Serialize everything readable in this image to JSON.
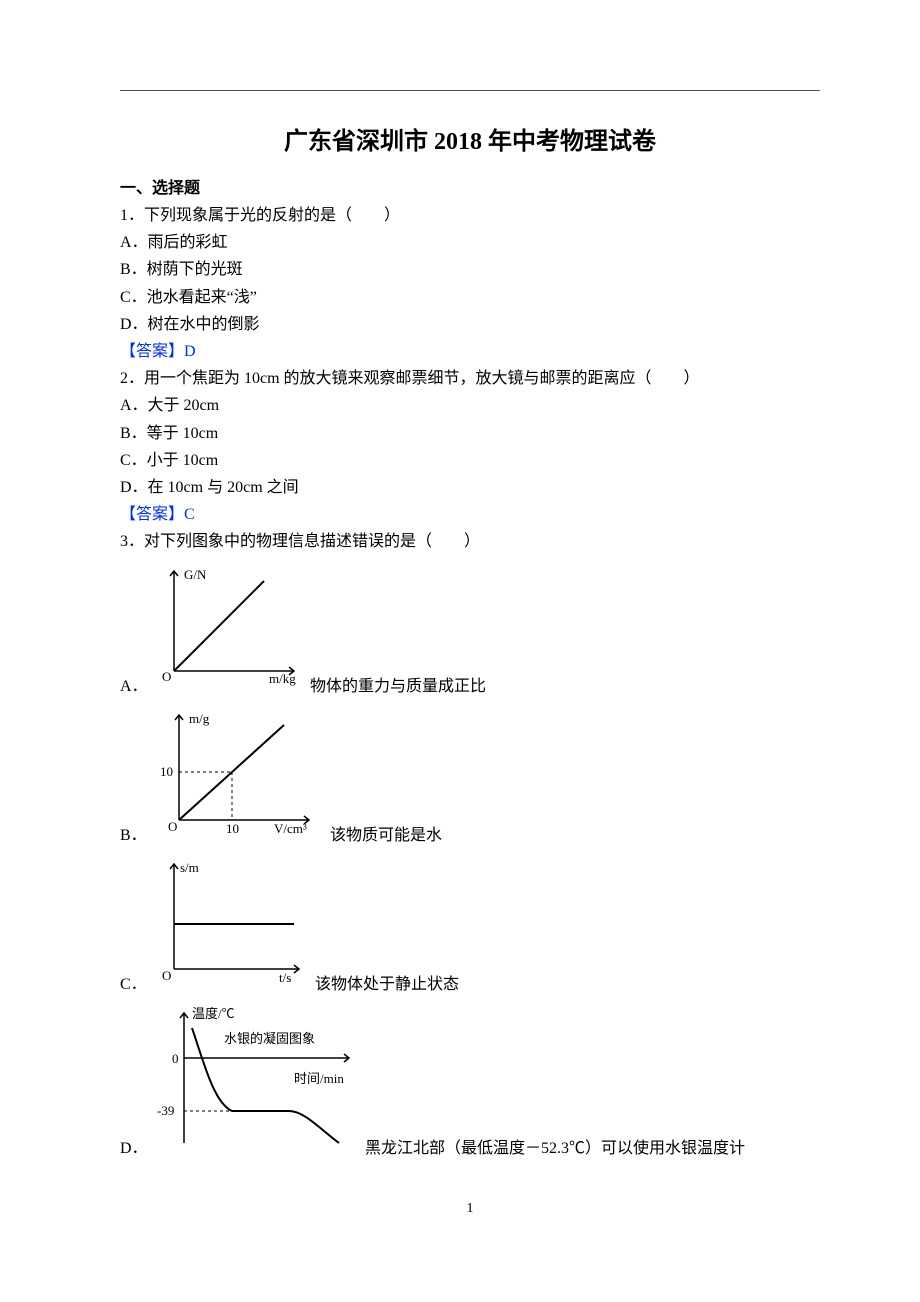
{
  "title": "广东省深圳市 2018 年中考物理试卷",
  "section1": "一、选择题",
  "q1": {
    "stem": "1．下列现象属于光的反射的是（　　）",
    "A": "A．雨后的彩虹",
    "B": "B．树荫下的光斑",
    "C": "C．池水看起来“浅”",
    "D": "D．树在水中的倒影",
    "ans": "【答案】D"
  },
  "q2": {
    "stem": "2．用一个焦距为 10cm 的放大镜来观察邮票细节，放大镜与邮票的距离应（　　）",
    "A": "A．大于 20cm",
    "B": "B．等于 10cm",
    "C": "C．小于 10cm",
    "D": "D．在 10cm 与 20cm 之间",
    "ans": "【答案】C"
  },
  "q3": {
    "stem": "3．对下列图象中的物理信息描述错误的是（　　）",
    "A_letter": "A．",
    "A_text": "物体的重力与质量成正比",
    "B_letter": "B．",
    "B_text": "该物质可能是水",
    "C_letter": "C．",
    "C_text": "该物体处于静止状态",
    "D_letter": "D．",
    "D_text": "黑龙江北部（最低温度－52.3℃）可以使用水银温度计"
  },
  "graphA": {
    "ylabel": "G/N",
    "xlabel": "m/kg",
    "origin": "O"
  },
  "graphB": {
    "ylabel": "m/g",
    "xlabel": "V/cm³",
    "ytick": "10",
    "xtick": "10",
    "origin": "O"
  },
  "graphC": {
    "ylabel": "s/m",
    "xlabel": "t/s",
    "origin": "O"
  },
  "graphD": {
    "ylabel": "温度/℃",
    "annot": "水银的凝固图象",
    "xlabel": "时间/min",
    "ytick0": "0",
    "ytick1": "-39"
  },
  "pageNum": "1",
  "chart_data": [
    {
      "type": "line",
      "name": "graphA G vs m",
      "xlabel": "m/kg",
      "ylabel": "G/N",
      "description": "straight line through origin, positive slope",
      "x": [
        0,
        1
      ],
      "y": [
        0,
        1
      ]
    },
    {
      "type": "line",
      "name": "graphB m vs V",
      "xlabel": "V/cm³",
      "ylabel": "m/g",
      "description": "straight line through origin passing through (10,10)",
      "x": [
        0,
        10
      ],
      "y": [
        0,
        10
      ]
    },
    {
      "type": "line",
      "name": "graphC s vs t",
      "xlabel": "t/s",
      "ylabel": "s/m",
      "description": "horizontal line at positive constant s",
      "x": [
        0,
        1
      ],
      "y": [
        0.3,
        0.3
      ]
    },
    {
      "type": "line",
      "name": "graphD temperature vs time (mercury solidification)",
      "xlabel": "时间/min",
      "ylabel": "温度/℃",
      "description": "cooling curve: decreases from above 0, plateau near -39 then decreases",
      "x": [
        0,
        2,
        6,
        8
      ],
      "y": [
        10,
        -39,
        -39,
        -55
      ]
    }
  ]
}
